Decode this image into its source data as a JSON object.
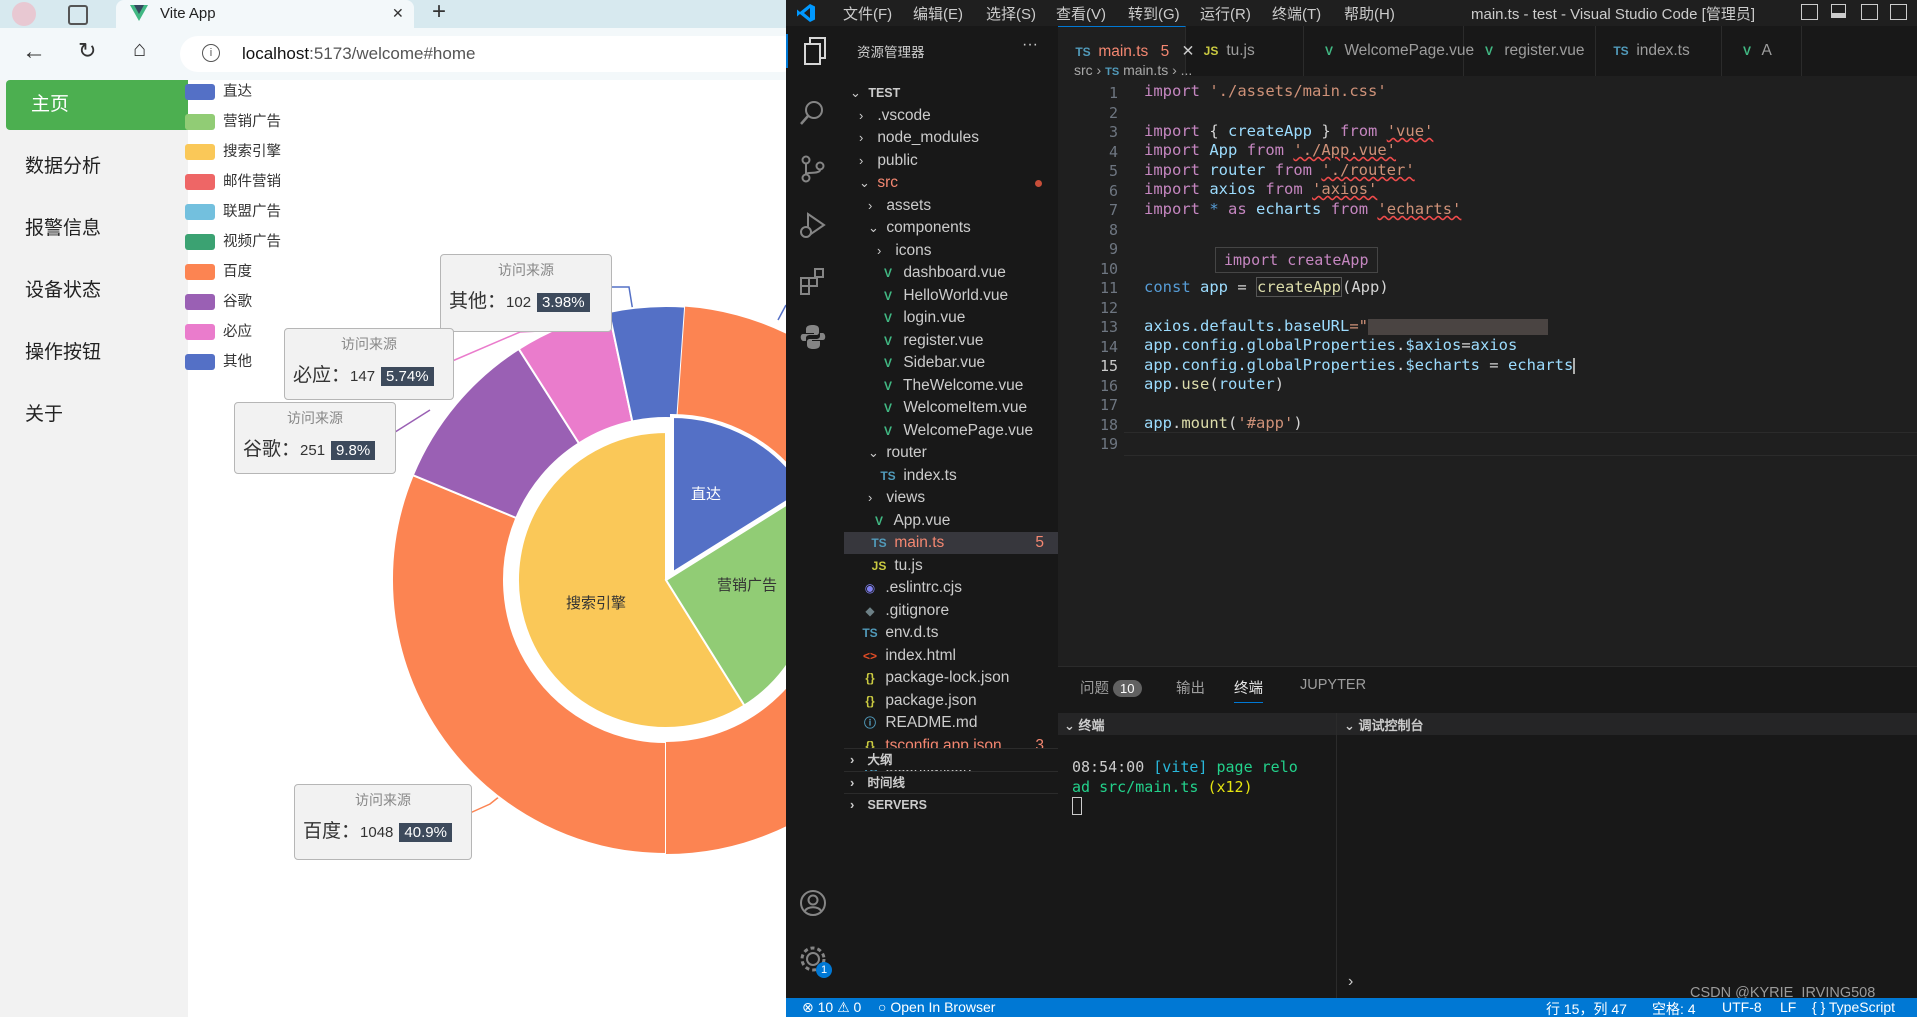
{
  "browser": {
    "tab_title": "Vite App",
    "tab_close": "✕",
    "new_tab": "+",
    "url_host": "localhost",
    "url_rest": ":5173/welcome#home",
    "sidebar": [
      "主页",
      "数据分析",
      "报警信息",
      "设备状态",
      "操作按钮",
      "关于"
    ],
    "legend": [
      {
        "label": "直达",
        "color": "#5470c6"
      },
      {
        "label": "营销广告",
        "color": "#91cc75"
      },
      {
        "label": "搜索引擎",
        "color": "#fac858"
      },
      {
        "label": "邮件营销",
        "color": "#ee6666"
      },
      {
        "label": "联盟广告",
        "color": "#73c0de"
      },
      {
        "label": "视频广告",
        "color": "#3ba272"
      },
      {
        "label": "百度",
        "color": "#fc8452"
      },
      {
        "label": "谷歌",
        "color": "#9a60b4"
      },
      {
        "label": "必应",
        "color": "#ea7ccc"
      },
      {
        "label": "其他",
        "color": "#5470c6"
      }
    ],
    "tooltips": [
      {
        "title": "访问来源",
        "name": "其他：",
        "count": "102",
        "pct": "3.98%"
      },
      {
        "title": "访问来源",
        "name": "必应：",
        "count": "147",
        "pct": "5.74%"
      },
      {
        "title": "访问来源",
        "name": "谷歌：",
        "count": "251",
        "pct": "9.8%"
      },
      {
        "title": "访问来源",
        "name": "百度：",
        "count": "1048",
        "pct": "40.9%"
      }
    ],
    "pie_labels": {
      "inner_zhida": "直达",
      "inner_yingxiao": "营销广告",
      "inner_sousuo": "搜索引擎"
    }
  },
  "chart_data": {
    "type": "pie",
    "inner": [
      {
        "name": "直达",
        "color": "#5470c6"
      },
      {
        "name": "营销广告",
        "color": "#91cc75"
      },
      {
        "name": "搜索引擎",
        "color": "#fac858"
      }
    ],
    "outer": [
      {
        "name": "百度",
        "value": 1048,
        "percent": 40.9,
        "color": "#fc8452"
      },
      {
        "name": "谷歌",
        "value": 251,
        "percent": 9.8,
        "color": "#9a60b4"
      },
      {
        "name": "必应",
        "value": 147,
        "percent": 5.74,
        "color": "#ea7ccc"
      },
      {
        "name": "其他",
        "value": 102,
        "percent": 3.98,
        "color": "#5470c6"
      }
    ]
  },
  "vscode": {
    "menu": [
      "文件(F)",
      "编辑(E)",
      "选择(S)",
      "查看(V)",
      "转到(G)",
      "运行(R)",
      "终端(T)",
      "帮助(H)"
    ],
    "window_title": "main.ts - test - Visual Studio Code [管理员]",
    "explorer_title": "资源管理器",
    "explorer_more": "···",
    "tabs": [
      {
        "icon": "TS",
        "label": "main.ts",
        "badge": "5",
        "close": "✕"
      },
      {
        "icon": "JS",
        "label": "tu.js"
      },
      {
        "icon": "V",
        "label": "WelcomePage.vue"
      },
      {
        "icon": "V",
        "label": "register.vue"
      },
      {
        "icon": "TS",
        "label": "index.ts"
      },
      {
        "icon": "V",
        "label": "A"
      }
    ],
    "breadcrumb": [
      "src",
      "main.ts",
      "..."
    ],
    "tree": [
      {
        "label": "TEST",
        "kind": "root"
      },
      {
        "label": ".vscode",
        "kind": "folder"
      },
      {
        "label": "node_modules",
        "kind": "folder"
      },
      {
        "label": "public",
        "kind": "folder"
      },
      {
        "label": "src",
        "kind": "folder-open"
      },
      {
        "label": "assets",
        "kind": "folder"
      },
      {
        "label": "components",
        "kind": "folder-open"
      },
      {
        "label": "icons",
        "kind": "folder"
      },
      {
        "label": "dashboard.vue",
        "kind": "vue"
      },
      {
        "label": "HelloWorld.vue",
        "kind": "vue"
      },
      {
        "label": "login.vue",
        "kind": "vue"
      },
      {
        "label": "register.vue",
        "kind": "vue"
      },
      {
        "label": "Sidebar.vue",
        "kind": "vue"
      },
      {
        "label": "TheWelcome.vue",
        "kind": "vue"
      },
      {
        "label": "WelcomeItem.vue",
        "kind": "vue"
      },
      {
        "label": "WelcomePage.vue",
        "kind": "vue"
      },
      {
        "label": "router",
        "kind": "folder-open"
      },
      {
        "label": "index.ts",
        "kind": "ts"
      },
      {
        "label": "views",
        "kind": "folder"
      },
      {
        "label": "App.vue",
        "kind": "vue"
      },
      {
        "label": "main.ts",
        "kind": "ts",
        "badge": "5"
      },
      {
        "label": "tu.js",
        "kind": "js"
      },
      {
        "label": ".eslintrc.cjs",
        "kind": "eslint"
      },
      {
        "label": ".gitignore",
        "kind": "git"
      },
      {
        "label": "env.d.ts",
        "kind": "ts"
      },
      {
        "label": "index.html",
        "kind": "html"
      },
      {
        "label": "package-lock.json",
        "kind": "json"
      },
      {
        "label": "package.json",
        "kind": "json"
      },
      {
        "label": "README.md",
        "kind": "info"
      },
      {
        "label": "tsconfig.app.json",
        "kind": "json",
        "badge": "3"
      },
      {
        "label": "tsconfig.json",
        "kind": "ts"
      }
    ],
    "sections": [
      "大纲",
      "时间线",
      "SERVERS"
    ],
    "hover_tip": "import createApp",
    "code_lines": [
      "1",
      "2",
      "3",
      "4",
      "5",
      "6",
      "7",
      "8",
      "9",
      "10",
      "11",
      "12",
      "13",
      "14",
      "15",
      "16",
      "17",
      "18",
      "19"
    ],
    "code": {
      "l1_kw": "import",
      "l1_str": "'./assets/main.css'",
      "l3_kw": "import",
      "l3_b1": "{ ",
      "l3_fn": "createApp",
      "l3_b2": " }",
      "l3_from": "from",
      "l3_str": "'vue'",
      "l4_kw": "import",
      "l4_id": "App",
      "l4_from": "from",
      "l4_str": "'./App.vue'",
      "l5_kw": "import",
      "l5_id": "router",
      "l5_from": "from",
      "l5_str": "'./router'",
      "l6_kw": "import",
      "l6_id": "axios",
      "l6_from": "from",
      "l6_str": "'axios'",
      "l7_kw": "import",
      "l7_star": "*",
      "l7_as": "as",
      "l7_id": "echarts",
      "l7_from": "from",
      "l7_str": "'echarts'",
      "l11_kw": "const",
      "l11_id": "app",
      "l11_eq": " = ",
      "l11_fn": "createApp",
      "l11_arg": "(App)",
      "l13_a": "axios",
      "l13_b": ".defaults.",
      "l13_c": "baseURL",
      "l13_d": "=\"",
      "l14_a": "app",
      "l14_b": ".config.",
      "l14_c": "globalProperties",
      "l14_d": ".",
      "l14_e": "$axios",
      "l14_f": "=",
      "l14_g": "axios",
      "l15_a": "app",
      "l15_b": ".config.",
      "l15_c": "globalProperties",
      "l15_d": ".",
      "l15_e": "$echarts",
      "l15_f": " = ",
      "l15_g": "echarts",
      "l16_a": "app",
      "l16_b": ".",
      "l16_c": "use",
      "l16_d": "(",
      "l16_e": "router",
      "l16_f": ")",
      "l18_a": "app",
      "l18_b": ".",
      "l18_c": "mount",
      "l18_d": "(",
      "l18_e": "'#app'",
      "l18_f": ")"
    },
    "panel_tabs": {
      "problems": "问题",
      "problems_count": "10",
      "output": "输出",
      "terminal": "终端",
      "jupyter": "JUPYTER"
    },
    "terminal_header": "终端",
    "debug_header": "调试控制台",
    "terminal": {
      "time": "08:54:00",
      "tag": "[vite]",
      "msg1": "page relo",
      "msg2": "ad src/main.ts",
      "count": "(x12)"
    },
    "watermark": "CSDN @KYRIE_IRVING508",
    "status": {
      "errors": "⊗ 10 ⚠ 0",
      "open_browser": "Open In Browser",
      "pos": "行 15，列 47",
      "spaces": "空格: 4",
      "enc": "UTF-8",
      "eol": "LF",
      "lang": "{ } TypeScript"
    },
    "settings_badge": "1"
  }
}
